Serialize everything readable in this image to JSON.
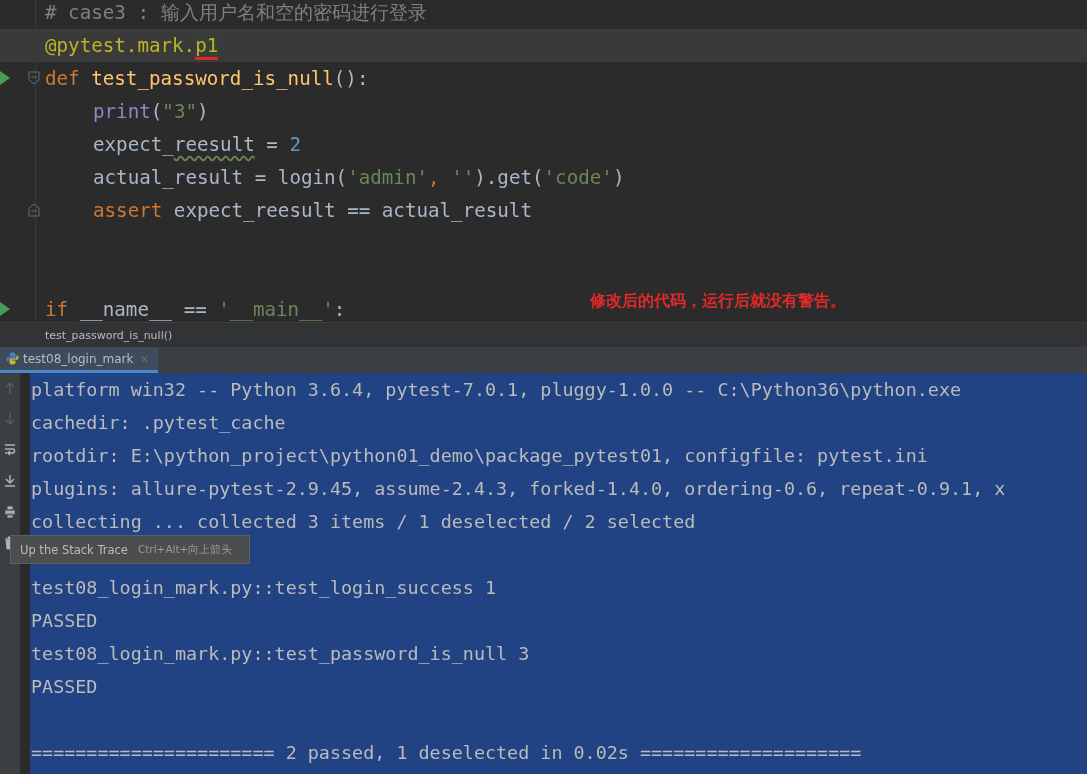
{
  "editor": {
    "lines": [
      {
        "run_marker": false,
        "fold_open": false,
        "fold_close": false,
        "current": false,
        "indented": false,
        "tokens": [
          {
            "kind": "comment",
            "text": "# case3 : 输入用户名和空的密码进行登录"
          }
        ]
      },
      {
        "run_marker": false,
        "fold_open": false,
        "fold_close": false,
        "current": true,
        "indented": false,
        "tokens": [
          {
            "kind": "decorator",
            "text": "@pytest.mark."
          },
          {
            "kind": "decorator",
            "text": "p1",
            "marked": true
          }
        ]
      },
      {
        "run_marker": true,
        "fold_open": true,
        "fold_close": false,
        "current": false,
        "indented": false,
        "tokens": [
          {
            "kind": "keyword",
            "text": "def "
          },
          {
            "kind": "function",
            "text": "test_password_is_null"
          },
          {
            "kind": "plain",
            "text": "():"
          }
        ]
      },
      {
        "run_marker": false,
        "fold_open": false,
        "fold_close": false,
        "current": false,
        "indented": true,
        "tokens": [
          {
            "kind": "builtin",
            "text": "print"
          },
          {
            "kind": "plain",
            "text": "("
          },
          {
            "kind": "string",
            "text": "\"3\""
          },
          {
            "kind": "plain",
            "text": ")"
          }
        ]
      },
      {
        "run_marker": false,
        "fold_open": false,
        "fold_close": false,
        "current": false,
        "indented": true,
        "tokens": [
          {
            "kind": "plain",
            "text": "expect_"
          },
          {
            "kind": "plain",
            "text": "reesult",
            "typo": true
          },
          {
            "kind": "plain",
            "text": " = "
          },
          {
            "kind": "number",
            "text": "2"
          }
        ]
      },
      {
        "run_marker": false,
        "fold_open": false,
        "fold_close": false,
        "current": false,
        "indented": true,
        "tokens": [
          {
            "kind": "plain",
            "text": "actual_result = login("
          },
          {
            "kind": "string",
            "text": "'admin'"
          },
          {
            "kind": "keyword",
            "text": ", "
          },
          {
            "kind": "string",
            "text": "''"
          },
          {
            "kind": "plain",
            "text": ").get("
          },
          {
            "kind": "string",
            "text": "'code'"
          },
          {
            "kind": "plain",
            "text": ")"
          }
        ]
      },
      {
        "run_marker": false,
        "fold_open": false,
        "fold_close": true,
        "current": false,
        "indented": true,
        "tokens": [
          {
            "kind": "keyword",
            "text": "assert"
          },
          {
            "kind": "plain",
            "text": " expect_reesult == actual_result"
          }
        ]
      },
      {
        "run_marker": false,
        "fold_open": false,
        "fold_close": false,
        "current": false
      },
      {
        "run_marker": false,
        "fold_open": false,
        "fold_close": false,
        "current": false
      },
      {
        "run_marker": true,
        "fold_open": false,
        "fold_close": false,
        "current": false,
        "indented": false,
        "tokens": [
          {
            "kind": "keyword",
            "text": "if"
          },
          {
            "kind": "plain",
            "text": " __name__ == "
          },
          {
            "kind": "string",
            "text": "'__main__'"
          },
          {
            "kind": "plain",
            "text": ":"
          }
        ]
      }
    ],
    "note": "修改后的代码，运行后就没有警告。"
  },
  "breadcrumb": "test_password_is_null()",
  "run_tabs": [
    {
      "label": "test08_login_mark",
      "close": "×",
      "selected": true
    }
  ],
  "console": {
    "selected": true,
    "blocks": [
      [
        "platform win32 -- Python 3.6.4, pytest-7.0.1, pluggy-1.0.0 -- C:\\Python36\\python.exe",
        "cachedir: .pytest_cache",
        "rootdir: E:\\python_project\\python01_demo\\package_pytest01, configfile: pytest.ini",
        "plugins: allure-pytest-2.9.45, assume-2.4.3, forked-1.4.0, ordering-0.6, repeat-0.9.1, x",
        "collecting ... collected 3 items / 1 deselected / 2 selected"
      ],
      [
        "test08_login_mark.py::test_login_success 1",
        "PASSED",
        "test08_login_mark.py::test_password_is_null 3",
        "PASSED"
      ],
      [
        "====================== 2 passed, 1 deselected in 0.02s ===================="
      ]
    ]
  },
  "tooltip": {
    "title": "Up the Stack Trace",
    "shortcut": "Ctrl+Alt+向上箭头"
  }
}
